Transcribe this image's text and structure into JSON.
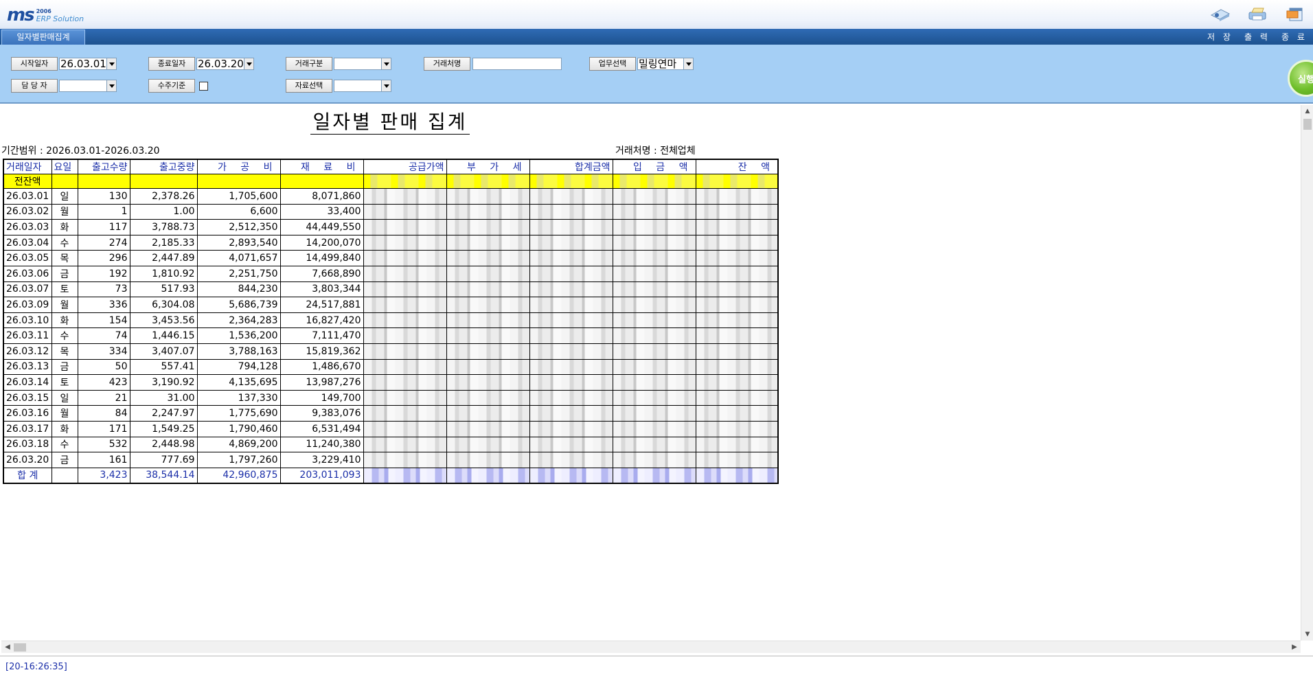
{
  "app": {
    "logo_mark": "ms",
    "logo_year": "2006",
    "logo_sub": "ERP Solution"
  },
  "toolbar": {
    "save_label": "저 장",
    "print_label": "출 력",
    "exit_label": "종 료"
  },
  "tab": {
    "label": "일자별판매집계"
  },
  "filters": {
    "start_date_label": "시작일자",
    "start_date_value": "26.03.01",
    "end_date_label": "종료일자",
    "end_date_value": "26.03.20",
    "trade_type_label": "거래구분",
    "trade_type_value": "",
    "client_name_label": "거래처명",
    "client_name_value": "",
    "business_label": "업무선택",
    "business_value": "밀링연마",
    "manager_label": "담 당 자",
    "manager_value": "",
    "order_basis_label": "수주기준",
    "data_select_label": "자료선택",
    "data_select_value": "",
    "run_label": "실행"
  },
  "report": {
    "title": "일자별 판매 집계",
    "period": "기간범위 : 2026.03.01-2026.03.20",
    "vendor": "거래처명 : 전체업체",
    "headers": [
      "거래일자",
      "요일",
      "출고수량",
      "출고중량",
      "가 공 비",
      "재 료 비",
      "공급가액",
      "부 가 세",
      "합계금액",
      "입 금 액",
      "잔   액"
    ],
    "carry_label": "전잔액",
    "rows": [
      [
        "26.03.01",
        "일",
        "130",
        "2,378.26",
        "1,705,600",
        "8,071,860"
      ],
      [
        "26.03.02",
        "월",
        "1",
        "1.00",
        "6,600",
        "33,400"
      ],
      [
        "26.03.03",
        "화",
        "117",
        "3,788.73",
        "2,512,350",
        "44,449,550"
      ],
      [
        "26.03.04",
        "수",
        "274",
        "2,185.33",
        "2,893,540",
        "14,200,070"
      ],
      [
        "26.03.05",
        "목",
        "296",
        "2,447.89",
        "4,071,657",
        "14,499,840"
      ],
      [
        "26.03.06",
        "금",
        "192",
        "1,810.92",
        "2,251,750",
        "7,668,890"
      ],
      [
        "26.03.07",
        "토",
        "73",
        "517.93",
        "844,230",
        "3,803,344"
      ],
      [
        "26.03.09",
        "월",
        "336",
        "6,304.08",
        "5,686,739",
        "24,517,881"
      ],
      [
        "26.03.10",
        "화",
        "154",
        "3,453.56",
        "2,364,283",
        "16,827,420"
      ],
      [
        "26.03.11",
        "수",
        "74",
        "1,446.15",
        "1,536,200",
        "7,111,470"
      ],
      [
        "26.03.12",
        "목",
        "334",
        "3,407.07",
        "3,788,163",
        "15,819,362"
      ],
      [
        "26.03.13",
        "금",
        "50",
        "557.41",
        "794,128",
        "1,486,670"
      ],
      [
        "26.03.14",
        "토",
        "423",
        "3,190.92",
        "4,135,695",
        "13,987,276"
      ],
      [
        "26.03.15",
        "일",
        "21",
        "31.00",
        "137,330",
        "149,700"
      ],
      [
        "26.03.16",
        "월",
        "84",
        "2,247.97",
        "1,775,690",
        "9,383,076"
      ],
      [
        "26.03.17",
        "화",
        "171",
        "1,549.25",
        "1,790,460",
        "6,531,494"
      ],
      [
        "26.03.18",
        "수",
        "532",
        "2,448.98",
        "4,869,200",
        "11,240,380"
      ],
      [
        "26.03.20",
        "금",
        "161",
        "777.69",
        "1,797,260",
        "3,229,410"
      ]
    ],
    "total": {
      "label": "합   계",
      "qty": "3,423",
      "weight": "38,544.14",
      "processing": "42,960,875",
      "material": "203,011,093"
    }
  },
  "status": {
    "text": "[20-16:26:35]"
  },
  "icons": {
    "save": "save-icon",
    "print": "print-icon",
    "exit": "exit-icon",
    "dropdown": "chevron-down-icon"
  },
  "colors": {
    "header_text": "#1a2ea8",
    "filter_panel": "#a5cff5",
    "carry_row": "#ffff00",
    "run_button": "#6fbf2b"
  }
}
